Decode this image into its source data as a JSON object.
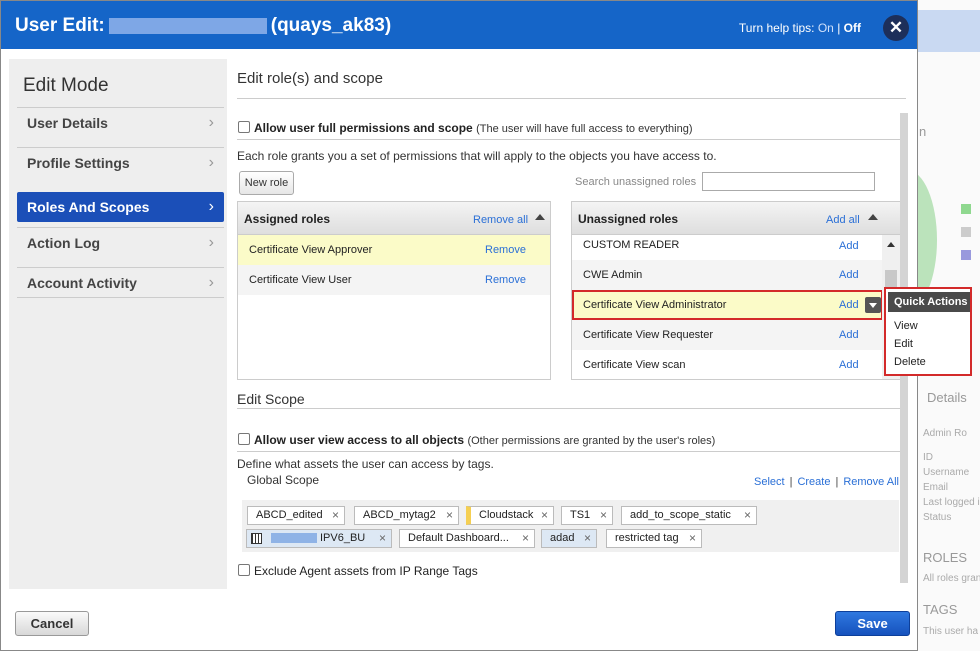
{
  "header": {
    "title_prefix": "User Edit:",
    "title_suffix": "(quays_ak83)",
    "help_label": "Turn help tips:",
    "help_on": "On",
    "help_sep": "|",
    "help_off": "Off",
    "close_icon": "close-icon"
  },
  "sidebar": {
    "title": "Edit Mode",
    "items": [
      {
        "label": "User Details"
      },
      {
        "label": "Profile Settings"
      },
      {
        "label": "Roles And Scopes"
      },
      {
        "label": "Action Log"
      },
      {
        "label": "Account Activity"
      }
    ],
    "active_index": 2
  },
  "main": {
    "section_title": "Edit role(s) and scope",
    "full_permissions_label": "Allow user full permissions and scope",
    "full_permissions_note": "(The user will have full access to everything)",
    "roles_desc": "Each role grants you a set of permissions that will apply to the objects you have access to.",
    "new_role_button": "New role",
    "search_label": "Search unassigned roles",
    "search_value": "",
    "assigned": {
      "title": "Assigned roles",
      "action": "Remove all",
      "rows": [
        {
          "name": "Certificate View Approver",
          "link": "Remove"
        },
        {
          "name": "Certificate View User",
          "link": "Remove"
        }
      ]
    },
    "unassigned": {
      "title": "Unassigned roles",
      "action": "Add all",
      "rows": [
        {
          "name": "CUSTOM READER",
          "link": "Add"
        },
        {
          "name": "CWE Admin",
          "link": "Add"
        },
        {
          "name": "Certificate View Administrator",
          "link": "Add"
        },
        {
          "name": "Certificate View Requester",
          "link": "Add"
        },
        {
          "name": "Certificate View scan",
          "link": "Add"
        }
      ]
    },
    "quick_actions": {
      "title": "Quick Actions",
      "items": [
        "View",
        "Edit",
        "Delete"
      ]
    },
    "scope_title": "Edit Scope",
    "view_access_label": "Allow user view access to all objects",
    "view_access_note": "(Other permissions are granted by the user's roles)",
    "define_text": "Define what assets the user can access by tags.",
    "global_scope": "Global Scope",
    "scope_links": [
      "Select",
      "Create",
      "Remove All"
    ],
    "tags": [
      {
        "label": "ABCD_edited"
      },
      {
        "label": "ABCD_mytag2"
      },
      {
        "label": "Cloudstack"
      },
      {
        "label": "TS1"
      },
      {
        "label": "add_to_scope_static"
      },
      {
        "label": "IPV6_BU"
      },
      {
        "label": "Default Dashboard..."
      },
      {
        "label": "adad"
      },
      {
        "label": "restricted tag"
      }
    ],
    "exclude_label": "Exclude Agent assets from IP Range Tags"
  },
  "footer": {
    "cancel": "Cancel",
    "save": "Save"
  },
  "background": {
    "details": "Details",
    "fields": [
      "ID",
      "Username",
      "Email",
      "Last logged in",
      "Status"
    ],
    "roles_heading": "ROLES",
    "roles_note": "All roles gran",
    "tags_heading": "TAGS",
    "tags_note": "This user ha",
    "n_label": "n",
    "admin_label": "Admin Ro"
  },
  "colors": {
    "header_blue": "#1565c8",
    "active_item": "#1b4fb8",
    "link_blue": "#2a6fd6",
    "highlight": "#fbfbc8",
    "save_blue": "#1652bd",
    "callout_red": "#d32a2a"
  }
}
